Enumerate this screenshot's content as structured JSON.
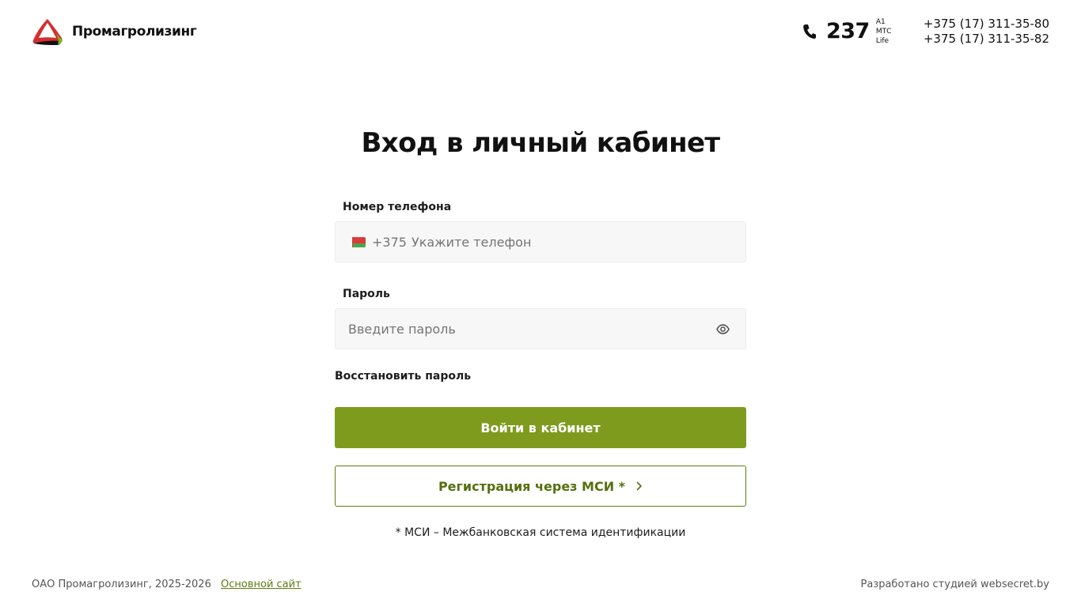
{
  "header": {
    "logo_text": "Промагролизинг",
    "short_number": "237",
    "operators": [
      "A1",
      "МТС",
      "Life"
    ],
    "phones": [
      "+375 (17) 311-35-80",
      "+375 (17) 311-35-82"
    ]
  },
  "login": {
    "title": "Вход в личный кабинет",
    "phone_label": "Номер телефона",
    "phone_prefix": "+375",
    "phone_placeholder": "Укажите телефон",
    "password_label": "Пароль",
    "password_placeholder": "Введите пароль",
    "forgot_password": "Восстановить пароль",
    "submit_label": "Войти в кабинет",
    "register_label": "Регистрация через МСИ *",
    "footnote": "* МСИ – Межбанковская система идентификации"
  },
  "footer": {
    "copyright": "ОАО Промагролизинг, 2025-2026",
    "main_site_link": "Основной сайт",
    "developer_credit": "Разработано студией websecret.by"
  },
  "colors": {
    "primary": "#7e9b1e",
    "outline": "#5f7a12",
    "flag_red": "#d83c3c",
    "flag_green": "#4aa84a"
  },
  "icons": [
    "logo-icon",
    "phone-icon",
    "belarus-flag-icon",
    "eye-icon",
    "chevron-right-icon"
  ]
}
